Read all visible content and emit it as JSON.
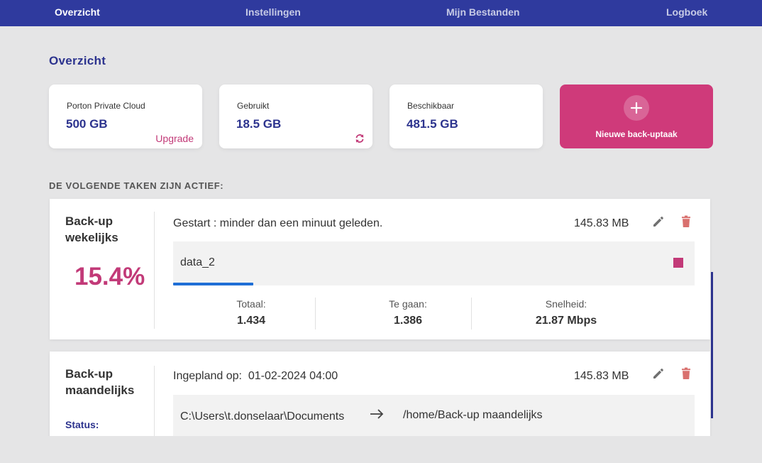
{
  "nav": {
    "items": [
      {
        "label": "Overzicht",
        "active": true
      },
      {
        "label": "Instellingen",
        "active": false
      },
      {
        "label": "Mijn Bestanden",
        "active": false
      },
      {
        "label": "Logboek",
        "active": false
      }
    ]
  },
  "page_title": "Overzicht",
  "stats": {
    "cloud": {
      "label": "Porton Private Cloud",
      "value": "500 GB",
      "action": "Upgrade"
    },
    "used": {
      "label": "Gebruikt",
      "value": "18.5 GB"
    },
    "available": {
      "label": "Beschikbaar",
      "value": "481.5 GB"
    }
  },
  "new_task_label": "Nieuwe back-uptaak",
  "section_heading": "DE VOLGENDE TAKEN ZIJN ACTIEF:",
  "tasks": [
    {
      "name": "Back-up wekelijks",
      "percent": "15.4%",
      "progress": 0.154,
      "status": "Gestart : minder dan een minuut geleden.",
      "size": "145.83 MB",
      "file": "data_2",
      "stats": [
        {
          "label": "Totaal:",
          "value": "1.434"
        },
        {
          "label": "Te gaan:",
          "value": "1.386"
        },
        {
          "label": "Snelheid:",
          "value": "21.87 Mbps"
        }
      ]
    },
    {
      "name": "Back-up maandelijks",
      "status_prefix": "Ingepland op:",
      "scheduled": "01-02-2024 04:00",
      "size": "145.83 MB",
      "source": "C:\\Users\\t.donselaar\\Documents",
      "destination": "/home/Back-up maandelijks",
      "status_label": "Status:"
    }
  ],
  "colors": {
    "nav_bg": "#2f3a9e",
    "accent": "#cf3a7a",
    "title": "#2c338e",
    "progress": "#1f6fd6"
  }
}
